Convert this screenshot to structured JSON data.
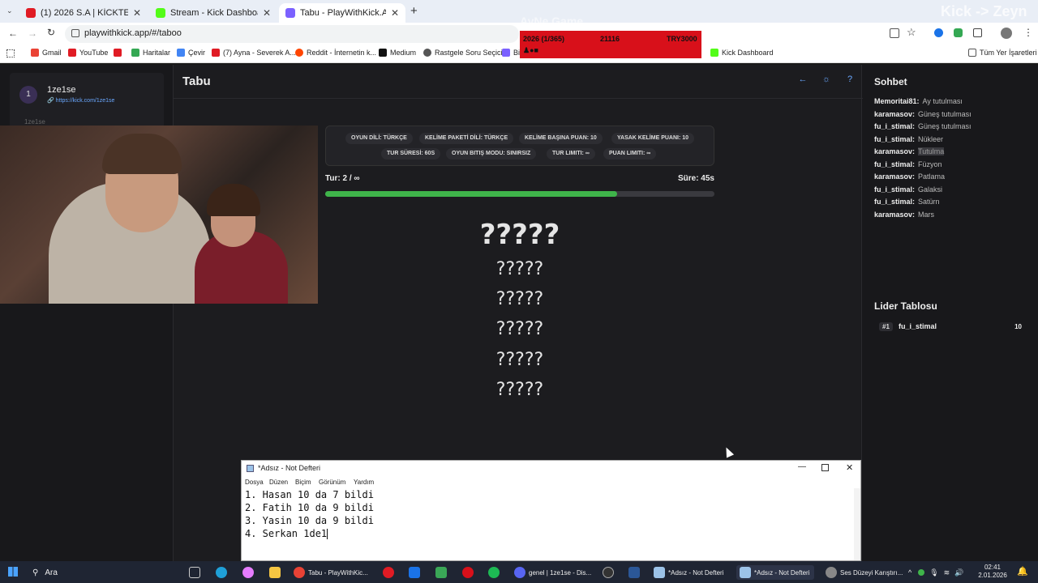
{
  "browser": {
    "tabs": [
      {
        "label": "(1) 2026 S.A | KİCKTE YAYINDAY",
        "favicon_color": "#e01b24"
      },
      {
        "label": "Stream - Kick Dashboard",
        "favicon_color": "#53fc18"
      },
      {
        "label": "Tabu - PlayWithKick.APP",
        "favicon_color": "#7b61ff"
      }
    ],
    "new_tab": "+",
    "url": "playwithkick.app/#/taboo",
    "bookmarks": [
      "Gmail",
      "YouTube",
      "Haritalar",
      "Çevir",
      "(7) Ayna - Severek A...",
      "Reddit - İnternetin k...",
      "Medium",
      "Rastgele Soru Seçici",
      "Bi",
      "Kick Dashboard"
    ],
    "all_bookmarks": "Tüm Yer İşaretleri"
  },
  "overlay": {
    "brand": "AyNe Game",
    "progress": "2026 (1/365)",
    "mid": "21116",
    "goal": "TRY3000",
    "kick_text": "Kick -> Zeyn"
  },
  "left": {
    "rank": "1",
    "username": "1ze1se",
    "link": "https://kick.com/1ze1se",
    "sub": "1ze1se"
  },
  "app": {
    "title": "Tabu",
    "settings": [
      "OYUN DİLİ: TÜRKÇE",
      "KELİME PAKETİ DİLİ: TÜRKÇE",
      "KELİME BAŞINA PUAN: 10",
      "YASAK KELİME PUANI: 10",
      "TUR SÜRESİ: 60S",
      "OYUN BITIŞ MODU: SINIRSIZ",
      "TUR LIMITI: ∞",
      "PUAN LIMITI: ∞"
    ],
    "round": "Tur: 2 / ∞",
    "time": "Süre: 45s",
    "progress_fraction": 0.75,
    "main_word": "?????",
    "forbidden": [
      "?????",
      "?????",
      "?????",
      "?????",
      "?????"
    ]
  },
  "chat": {
    "title": "Sohbet",
    "messages": [
      {
        "user": "Memoritai81:",
        "text": "Ay tutulması"
      },
      {
        "user": "karamasov:",
        "text": "Güneş tutulması"
      },
      {
        "user": "fu_i_stimal:",
        "text": "Güneş tutulması"
      },
      {
        "user": "fu_i_stimal:",
        "text": "Nükleer"
      },
      {
        "user": "karamasov:",
        "text": "Tutulma"
      },
      {
        "user": "fu_i_stimal:",
        "text": "Füzyon"
      },
      {
        "user": "karamasov:",
        "text": "Patlama"
      },
      {
        "user": "fu_i_stimal:",
        "text": "Galaksi"
      },
      {
        "user": "fu_i_stimal:",
        "text": "Satürn"
      },
      {
        "user": "karamasov:",
        "text": "Mars"
      }
    ]
  },
  "leaderboard": {
    "title": "Lider Tablosu",
    "rows": [
      {
        "rank": "#1",
        "name": "fu_i_stimal",
        "score": "10"
      }
    ]
  },
  "notepad": {
    "title": "*Adsız - Not Defteri",
    "menu": [
      "Dosya",
      "Düzen",
      "Biçim",
      "Görünüm",
      "Yardım"
    ],
    "lines": [
      "1. Hasan 10 da 7 bildi",
      "2. Fatih 10 da 9 bildi",
      "3. Yasin 10 da 9 bildi",
      "4. Serkan 1de1"
    ]
  },
  "taskbar": {
    "search": "Ara",
    "items": [
      "Tabu - PlayWithKic...",
      "genel | 1ze1se - Dis...",
      "*Adsız - Not Defteri",
      "*Adsız - Not Defteri",
      "Ses Düzeyi Karıştırı..."
    ],
    "time": "02:41",
    "date": "2.01.2026"
  }
}
